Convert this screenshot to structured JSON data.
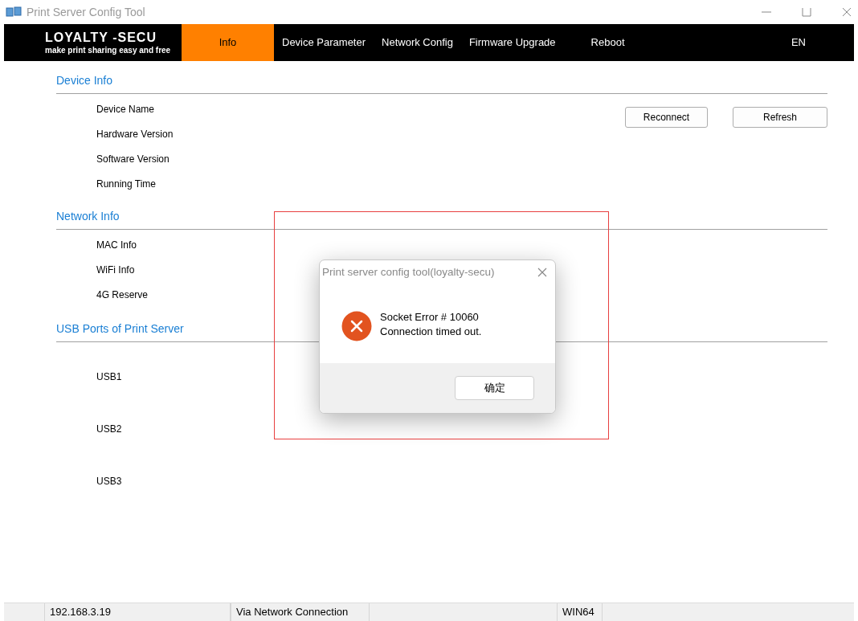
{
  "window": {
    "title": "Print Server Config Tool"
  },
  "nav": {
    "brand": "LOYALTY -SECU",
    "tagline": "make print sharing easy and free",
    "language": "EN",
    "tabs": [
      {
        "label": "Info",
        "selected": true
      },
      {
        "label": "Device Parameter",
        "selected": false
      },
      {
        "label": "Network Config",
        "selected": false
      },
      {
        "label": "Firmware Upgrade",
        "selected": false
      },
      {
        "label": "Reboot",
        "selected": false
      }
    ]
  },
  "sections": [
    {
      "title": "Device Info",
      "kind": "compact",
      "rows": [
        "Device Name",
        "Hardware Version",
        "Software Version",
        "Running Time"
      ],
      "buttons": [
        "Reconnect",
        "Refresh"
      ]
    },
    {
      "title": "Network Info",
      "kind": "compact",
      "rows": [
        "MAC Info",
        "WiFi Info",
        "4G Reserve"
      ]
    },
    {
      "title": "USB Ports of Print Server",
      "kind": "tall",
      "rows": [
        "USB1",
        "USB2",
        "USB3"
      ]
    }
  ],
  "dialog": {
    "title": "Print server config tool(loyalty-secu)",
    "lines": [
      "Socket Error # 10060",
      "Connection timed out."
    ],
    "button": "确定"
  },
  "status_bar": [
    "192.168.3.19",
    "Via Network Connection",
    "WIN64"
  ]
}
